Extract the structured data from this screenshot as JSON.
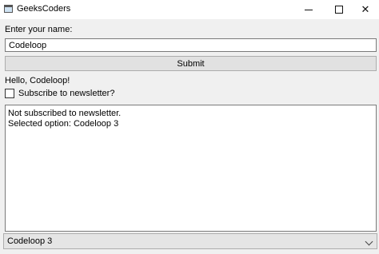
{
  "window": {
    "title": "GeeksCoders"
  },
  "form": {
    "name_label": "Enter your name:",
    "name_value": "Codeloop",
    "submit_label": "Submit",
    "greeting": "Hello, Codeloop!",
    "newsletter_label": "Subscribe to newsletter?",
    "newsletter_checked": false
  },
  "output": {
    "lines": [
      "Not subscribed to newsletter.",
      "Selected option: Codeloop 3"
    ]
  },
  "combo": {
    "selected": "Codeloop 3"
  }
}
